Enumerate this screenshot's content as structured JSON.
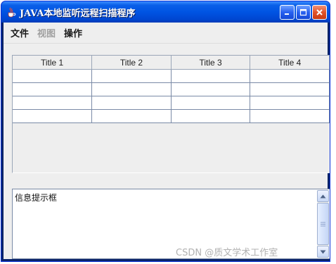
{
  "window": {
    "title": "JAVA本地监听远程扫描程序",
    "icon": "java-cup-icon"
  },
  "menu": {
    "items": [
      {
        "label": "文件",
        "enabled": true
      },
      {
        "label": "视图",
        "enabled": false
      },
      {
        "label": "操作",
        "enabled": true
      }
    ]
  },
  "table": {
    "columns": [
      "Title 1",
      "Title 2",
      "Title 3",
      "Title 4"
    ],
    "rows": [
      [
        "",
        "",
        "",
        ""
      ],
      [
        "",
        "",
        "",
        ""
      ],
      [
        "",
        "",
        "",
        ""
      ],
      [
        "",
        "",
        "",
        ""
      ]
    ]
  },
  "info_box": {
    "text": "信息提示框"
  },
  "watermark": "CSDN @质文学术工作室",
  "colors": {
    "titlebar": "#0054e3",
    "close_button": "#e2532a",
    "grid_line": "#7a8aa6"
  }
}
